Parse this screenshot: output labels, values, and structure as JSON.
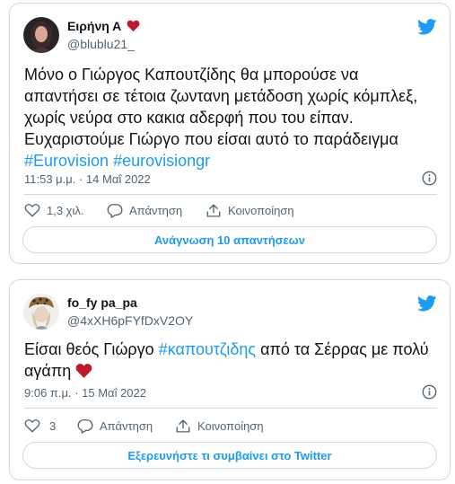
{
  "tweets": [
    {
      "display_name": "Ειρήνη Α",
      "name_emoji": "red-heart",
      "handle": "@blublu21_",
      "text_plain": "Μόνο ο Γιώργος Καπουτζίδης θα μπορούσε να\nαπαντήσει σε τέτοια ζωντανη μετάδοση χωρίς κόμπλεξ,\nχωρίς νεύρα στο κακια αδερφή που του είπαν.\nΕυχαριστούμε Γιώργο που είσαι αυτό το παράδειγμα\n",
      "hashtag_1": "#Eurovision",
      "hashtag_2": "#eurovisiongr",
      "timestamp": "11:53 μ.μ. · 14 Μαΐ 2022",
      "likes": "1,3 χιλ.",
      "reply_label": "Απάντηση",
      "share_label": "Κοινοποίηση",
      "footer_button": "Ανάγνωση 10 απαντήσεων"
    },
    {
      "display_name": "fo_fy pa_pa",
      "handle": "@4xXH6pFYfDxV2OY",
      "text_before": "Είσαι θεός Γιώργο ",
      "hashtag": "#καπουτζιδης",
      "text_after": " από τα Σέρρας με πολύ\nαγάπη ",
      "text_emoji": "red-heart",
      "timestamp": "9:06 π.μ. · 15 Μαΐ 2022",
      "likes": "3",
      "reply_label": "Απάντηση",
      "share_label": "Κοινοποίηση",
      "footer_button": "Εξερευνήστε τι συμβαίνει στο Twitter"
    }
  ],
  "icons": {
    "brand": "twitter-bird-icon",
    "info": "info-icon",
    "like": "heart-outline-icon",
    "reply": "reply-bubble-icon",
    "share": "share-upload-icon"
  },
  "colors": {
    "brand_blue": "#1d9bf0",
    "heart_red": "#be1931",
    "text_primary": "#0f1419",
    "text_secondary": "#536471",
    "border": "#cfd9de"
  }
}
